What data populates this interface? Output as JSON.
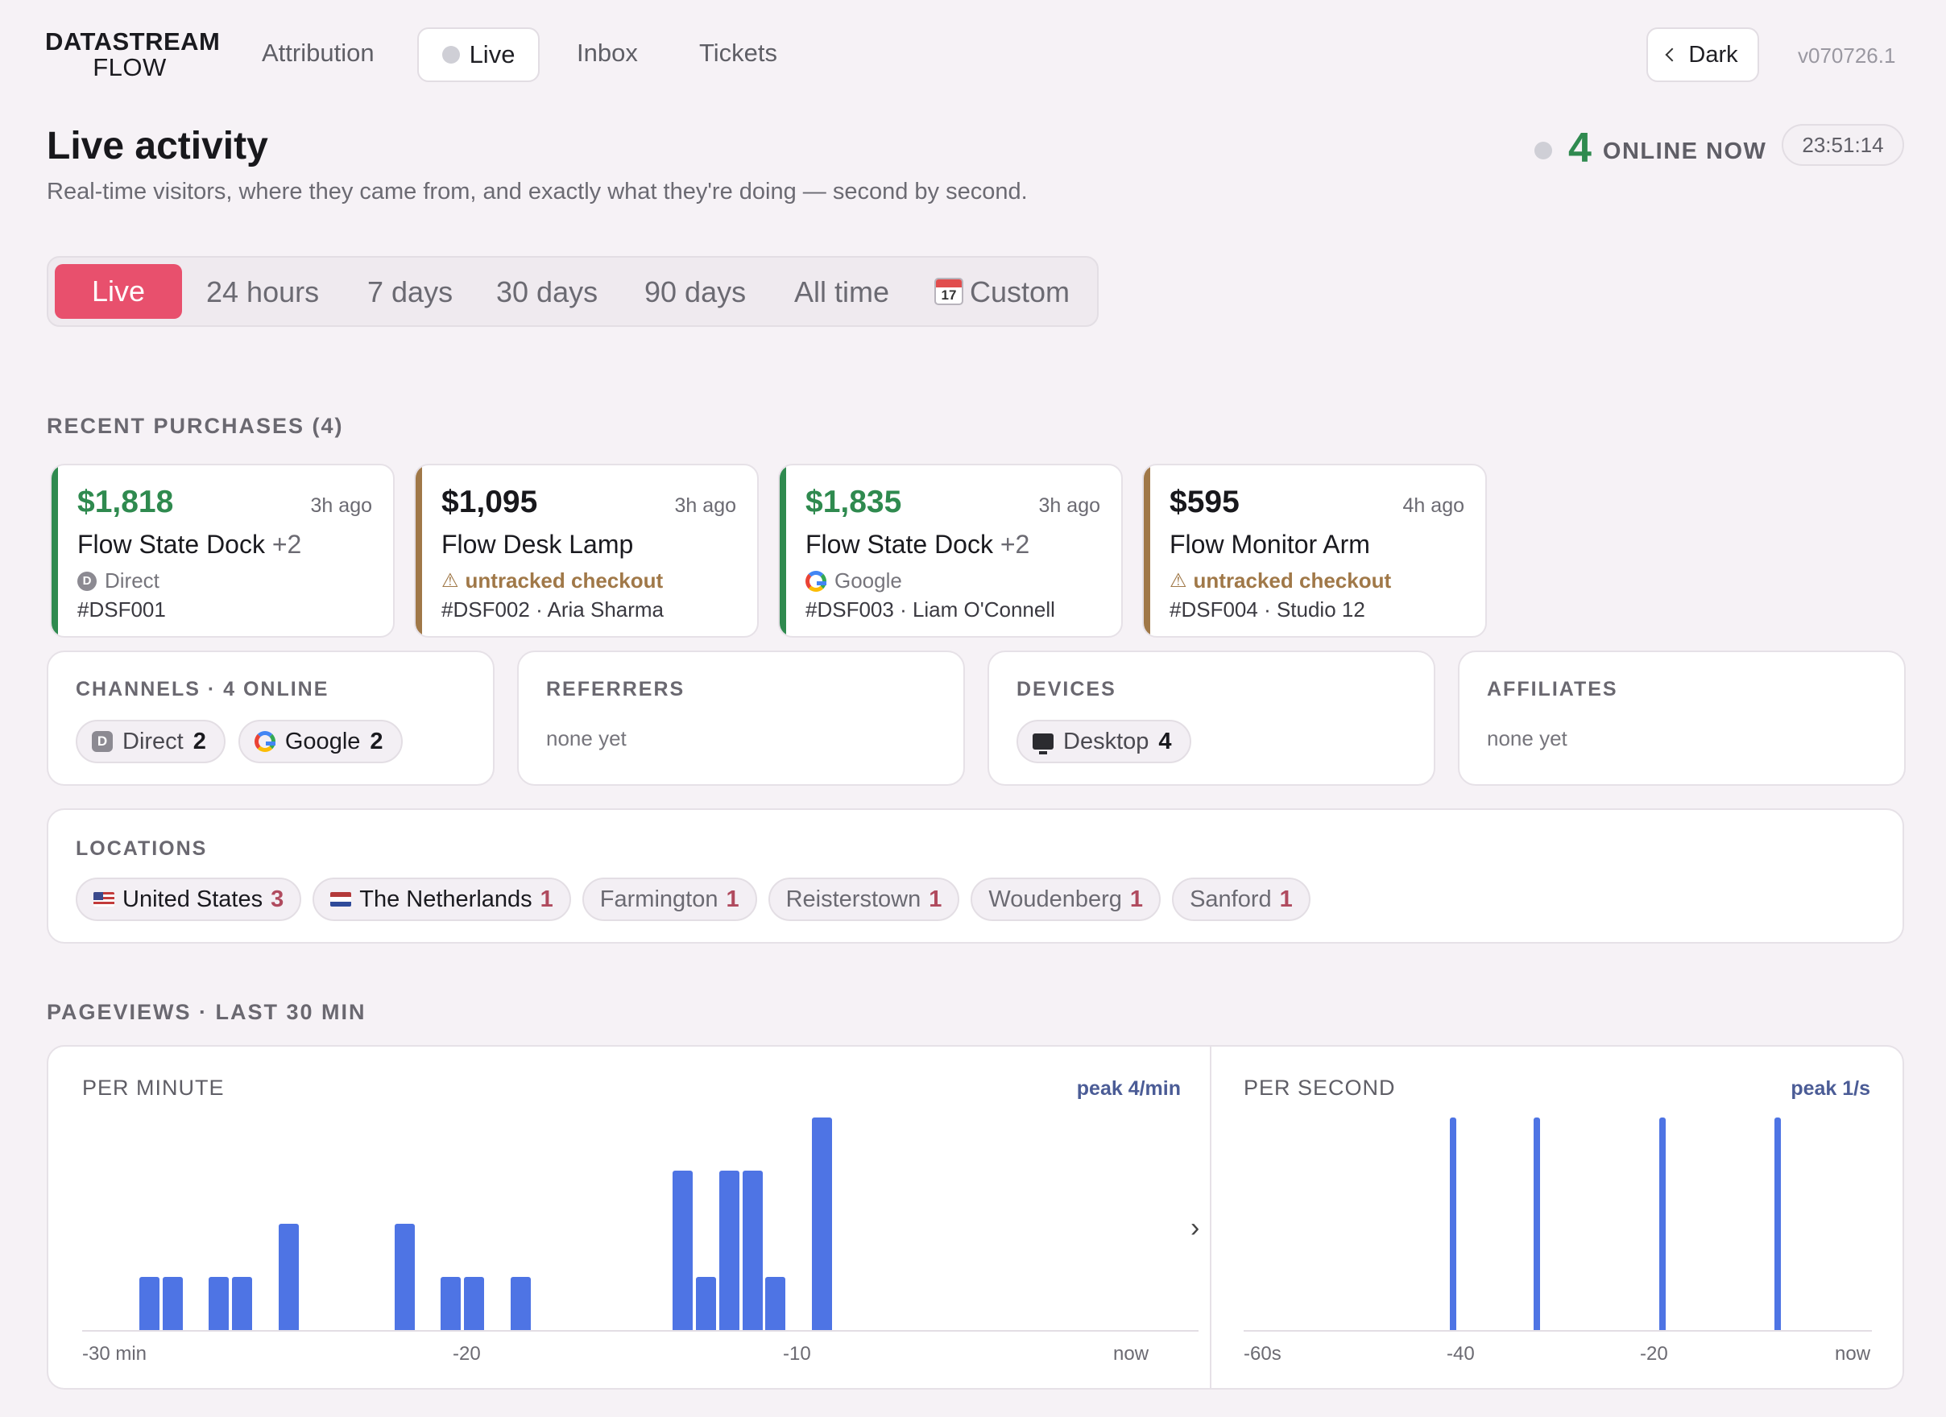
{
  "nav": {
    "logo_line1": "DATASTREAM",
    "logo_line2": "FLOW",
    "links": [
      "Attribution",
      "Live",
      "Inbox",
      "Tickets"
    ],
    "theme_label": "Dark",
    "version": "v070726.1"
  },
  "header": {
    "title": "Live activity",
    "subtitle": "Real-time visitors, where they came from, and exactly what they're doing — second by second.",
    "online_count": "4",
    "online_label": "ONLINE NOW",
    "clock": "23:51:14"
  },
  "ranges": {
    "items": [
      "Live",
      "24 hours",
      "7 days",
      "30 days",
      "90 days",
      "All time",
      "Custom"
    ],
    "calendar_day": "17",
    "selected": "Live"
  },
  "purchases": {
    "heading": "RECENT PURCHASES (4)",
    "items": [
      {
        "amount": "$1,818",
        "ago": "3h ago",
        "product": "Flow State Dock",
        "more": "+2",
        "source": "Direct",
        "ref": "#DSF001",
        "accent": "#2f8a4f"
      },
      {
        "amount": "$1,095",
        "ago": "3h ago",
        "product": "Flow Desk Lamp",
        "more": "",
        "source": "untracked checkout",
        "ref": "#DSF002 · Aria Sharma",
        "accent": "#a07848"
      },
      {
        "amount": "$1,835",
        "ago": "3h ago",
        "product": "Flow State Dock",
        "more": "+2",
        "source": "Google",
        "ref": "#DSF003 · Liam O'Connell",
        "accent": "#2f8a4f"
      },
      {
        "amount": "$595",
        "ago": "4h ago",
        "product": "Flow Monitor Arm",
        "more": "",
        "source": "untracked checkout",
        "ref": "#DSF004 · Studio 12",
        "accent": "#a07848"
      }
    ]
  },
  "stats": {
    "channels": {
      "heading": "CHANNELS · 4 ONLINE",
      "items": [
        {
          "label": "Direct",
          "count": "2"
        },
        {
          "label": "Google",
          "count": "2"
        }
      ]
    },
    "referrers": {
      "heading": "REFERRERS",
      "empty": "none yet"
    },
    "devices": {
      "heading": "DEVICES",
      "items": [
        {
          "label": "Desktop",
          "count": "4"
        }
      ]
    },
    "affiliates": {
      "heading": "AFFILIATES",
      "empty": "none yet"
    }
  },
  "locations": {
    "heading": "LOCATIONS",
    "items": [
      {
        "label": "United States",
        "count": "3",
        "flag": "us"
      },
      {
        "label": "The Netherlands",
        "count": "1",
        "flag": "nl"
      },
      {
        "label": "Farmington",
        "count": "1"
      },
      {
        "label": "Reisterstown",
        "count": "1"
      },
      {
        "label": "Woudenberg",
        "count": "1"
      },
      {
        "label": "Sanford",
        "count": "1"
      }
    ]
  },
  "pageviews": {
    "heading": "PAGEVIEWS · LAST 30 MIN",
    "per_minute": {
      "label": "PER MINUTE",
      "peak": "peak 4/min",
      "ticks": [
        "-30 min",
        "-20",
        "-10",
        "now"
      ]
    },
    "per_second": {
      "label": "PER SECOND",
      "peak": "peak 1/s",
      "ticks": [
        "-60s",
        "-40",
        "-20",
        "now"
      ]
    }
  },
  "chart_data": [
    {
      "type": "bar",
      "title": "PER MINUTE",
      "x": [
        -30,
        -29,
        -28,
        -27,
        -26,
        -25,
        -24,
        -23,
        -22,
        -21,
        -20,
        -19,
        -18,
        -17,
        -16,
        -15,
        -14,
        -13,
        -12,
        -11,
        -10,
        -9,
        -8,
        -7,
        -6,
        -5,
        -4,
        -3,
        -2,
        -1,
        0
      ],
      "values": [
        0,
        1,
        1,
        0,
        1,
        1,
        0,
        2,
        0,
        0,
        0,
        0,
        2,
        0,
        1,
        1,
        0,
        1,
        0,
        0,
        0,
        0,
        0,
        0,
        3,
        1,
        3,
        3,
        1,
        0,
        4
      ],
      "ylim": [
        0,
        4
      ],
      "color": "#4e74e4"
    },
    {
      "type": "bar",
      "title": "PER SECOND",
      "x_ticks": [
        "-60s",
        "-40",
        "-20",
        "now"
      ],
      "x": [
        -40,
        -32,
        -20,
        -9
      ],
      "values": [
        1,
        1,
        1,
        1
      ],
      "xlim": [
        -60,
        0
      ],
      "ylim": [
        0,
        1
      ],
      "color": "#4e74e4"
    }
  ]
}
